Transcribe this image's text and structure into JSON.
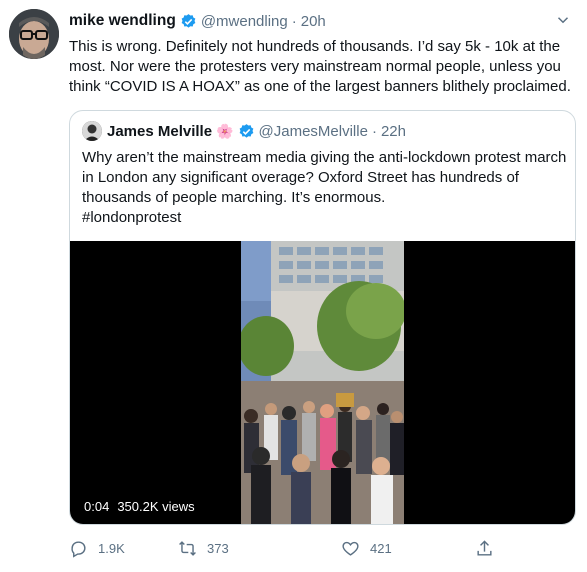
{
  "tweet": {
    "author_name": "mike wendling",
    "handle": "@mwendling",
    "time": "20h",
    "text": "This is wrong. Definitely not hundreds of thousands. I’d say 5k - 10k at the most. Nor were the protesters very mainstream normal people, unless you think “COVID IS A HOAX” as one of the largest banners blithely proclaimed.",
    "verified_icon": "verified-badge-icon",
    "more_icon": "more-icon"
  },
  "quote": {
    "author_name": "James Melville",
    "flower_icon": "🌸",
    "handle": "@JamesMelville",
    "time": "22h",
    "text": "Why aren’t the mainstream media giving the anti-lockdown protest march in London any significant overage? Oxford Street has hundreds of thousands of people marching. It’s enormous.",
    "hashtag": "#londonprotest",
    "video": {
      "duration": "0:04",
      "views": "350.2K views"
    }
  },
  "actions": {
    "reply_count": "1.9K",
    "retweet_count": "373",
    "like_count": "421"
  },
  "colors": {
    "accent": "#1d9bf0",
    "secondary_text": "#5b7083",
    "border": "#cfd9de"
  }
}
